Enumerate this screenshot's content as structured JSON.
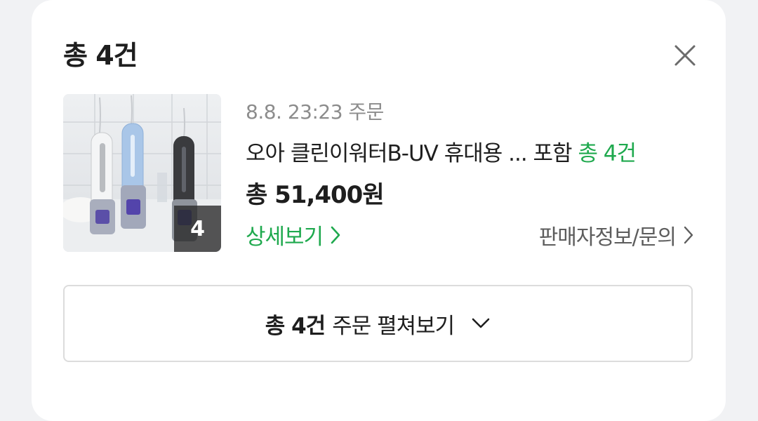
{
  "header": {
    "title": "총 4건"
  },
  "order": {
    "date_label": "8.8. 23:23 주문",
    "product_name": "오아 클린이워터B-UV 휴대용 ... 포함",
    "product_count_label": "총 4건",
    "total_price": "총 51,400원",
    "thumbnail_count": "4",
    "detail_link": "상세보기",
    "seller_link": "판매자정보/문의"
  },
  "expand": {
    "count_label": "총 4건",
    "action_label": "주문 펼쳐보기"
  },
  "colors": {
    "accent_green": "#1fa94e",
    "text_primary": "#1e1e1e",
    "text_secondary": "#8c8c8c",
    "background": "#f1f2f4"
  },
  "icons": {
    "close": "close-icon",
    "detail_chevron": "chevron-right-icon",
    "seller_chevron": "chevron-right-icon",
    "expand_chevron": "chevron-down-icon"
  }
}
